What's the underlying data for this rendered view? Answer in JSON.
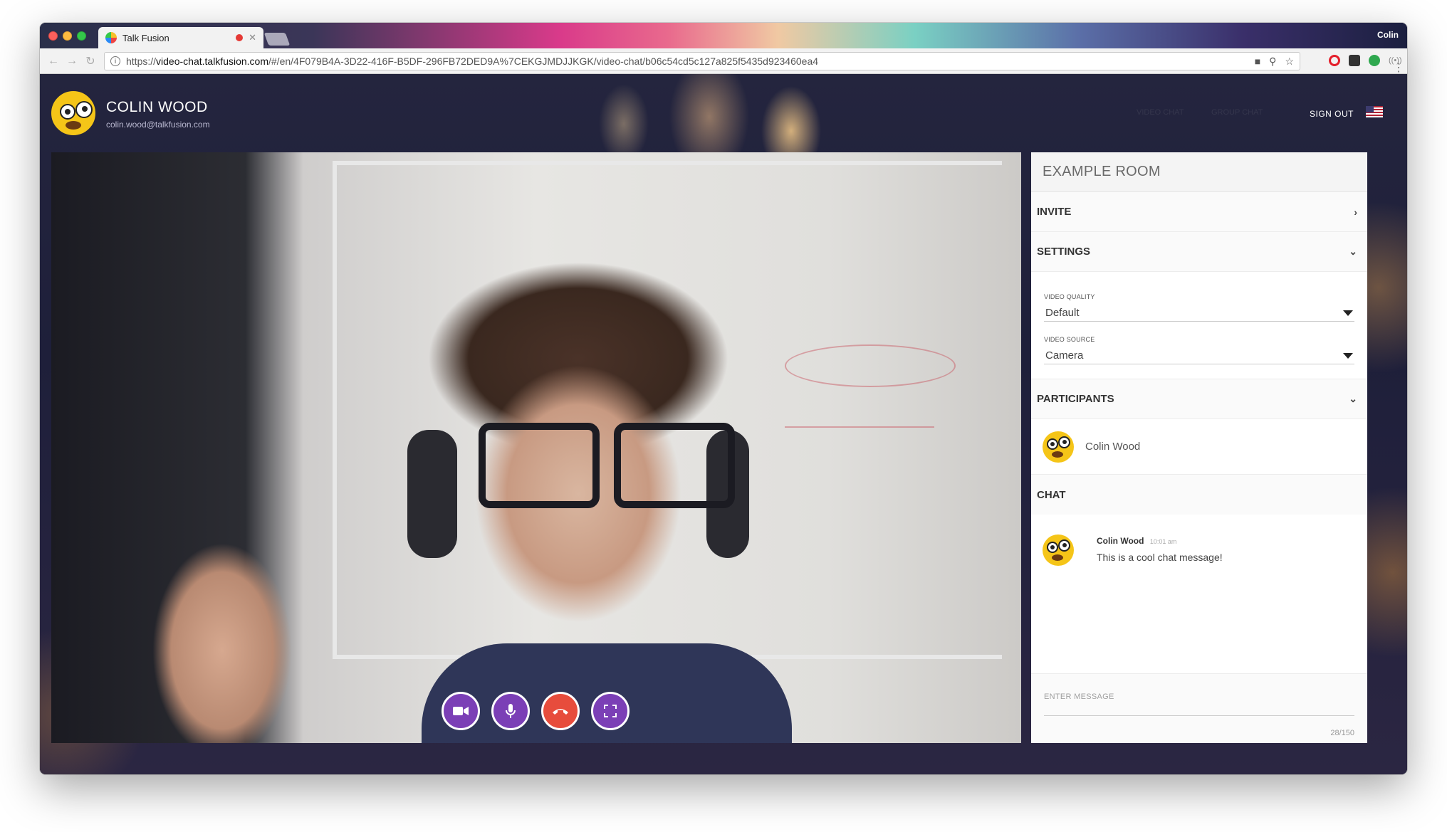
{
  "browser": {
    "tab_title": "Talk Fusion",
    "profile_name": "Colin",
    "url_prefix": "https://",
    "url_host": "video-chat.talkfusion.com",
    "url_path": "/#/en/4F079B4A-3D22-416F-B5DF-296FB72DED9A%7CEKGJMDJJKGK/video-chat/b06c54cd5c127a825f5435d923460ea4"
  },
  "header": {
    "user_name": "COLIN WOOD",
    "user_email": "colin.wood@talkfusion.com",
    "nav_video_chat": "VIDEO CHAT",
    "nav_second": "GROUP CHAT",
    "sign_out": "SIGN OUT"
  },
  "sidebar": {
    "room_title": "EXAMPLE ROOM",
    "invite_label": "INVITE",
    "settings_label": "SETTINGS",
    "video_quality_label": "VIDEO QUALITY",
    "video_quality_value": "Default",
    "video_source_label": "VIDEO SOURCE",
    "video_source_value": "Camera",
    "participants_label": "PARTICIPANTS",
    "participants": [
      {
        "name": "Colin Wood"
      }
    ],
    "chat_label": "CHAT",
    "messages": [
      {
        "author": "Colin Wood",
        "time": "10:01 am",
        "text": "This is a cool chat message!"
      }
    ],
    "input_placeholder": "ENTER MESSAGE",
    "char_counter": "28/150"
  },
  "controls": {
    "camera": "video-camera-icon",
    "mic": "microphone-icon",
    "hangup": "hang-up-icon",
    "fullscreen": "fullscreen-icon"
  },
  "colors": {
    "control_purple": "#7b3fb6",
    "hangup_red": "#e74c3c",
    "avatar_yellow": "#f5c518"
  }
}
